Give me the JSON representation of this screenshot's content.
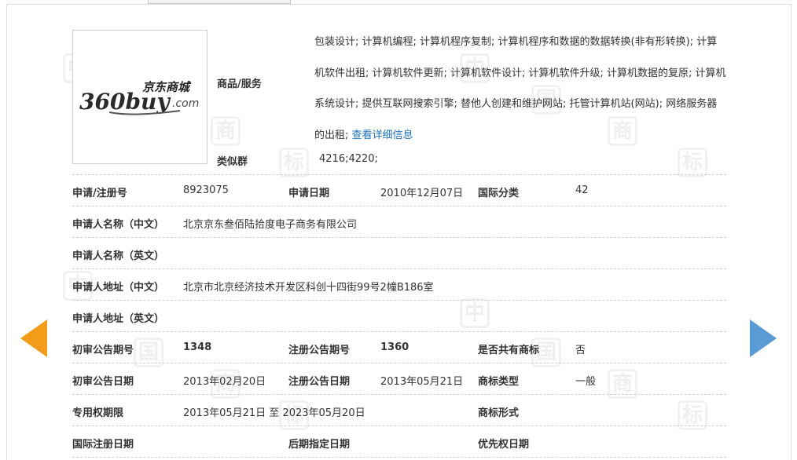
{
  "logo": {
    "brand_cn": "京东商城",
    "brand_en": "360buy",
    "brand_dotcom": ".com"
  },
  "goods": {
    "label": "商品/服务",
    "text": "包装设计; 计算机编程; 计算机程序复制; 计算机程序和数据的数据转换(非有形转换); 计算机软件出租; 计算机软件更新; 计算机软件设计; 计算机软件升级; 计算机数据的复原; 计算机系统设计; 提供互联网搜索引擎; 替他人创建和维护网站; 托管计算机站(网站); 网络服务器的出租; ",
    "detail_link": "查看详细信息"
  },
  "similar_group": {
    "label": "类似群",
    "value": "4216;4220;"
  },
  "reg_no": {
    "label": "申请/注册号",
    "value": "8923075"
  },
  "apply_date": {
    "label": "申请日期",
    "value": "2010年12月07日"
  },
  "intl_class": {
    "label": "国际分类",
    "value": "42"
  },
  "applicant_cn": {
    "label": "申请人名称（中文）",
    "value": "北京京东叁佰陆拾度电子商务有限公司"
  },
  "applicant_en": {
    "label": "申请人名称（英文）",
    "value": ""
  },
  "address_cn": {
    "label": "申请人地址（中文）",
    "value": "北京市北京经济技术开发区科创十四街99号2幢B186室"
  },
  "address_en": {
    "label": "申请人地址（英文）",
    "value": ""
  },
  "prelim_issue": {
    "label": "初审公告期号",
    "value": "1348"
  },
  "reg_issue": {
    "label": "注册公告期号",
    "value": "1360"
  },
  "shared": {
    "label": "是否共有商标",
    "value": "否"
  },
  "prelim_date": {
    "label": "初审公告日期",
    "value": "2013年02月20日"
  },
  "reg_date": {
    "label": "注册公告日期",
    "value": "2013年05月21日"
  },
  "tm_type": {
    "label": "商标类型",
    "value": "一般"
  },
  "exclusive": {
    "label": "专用权期限",
    "value": "2013年05月21日 至 2023年05月20日"
  },
  "tm_form": {
    "label": "商标形式",
    "value": ""
  },
  "intl_reg_date": {
    "label": "国际注册日期",
    "value": ""
  },
  "later_designation": {
    "label": "后期指定日期",
    "value": ""
  },
  "priority_date": {
    "label": "优先权日期",
    "value": ""
  },
  "watermark": {
    "chars": [
      "中",
      "国",
      "商",
      "标"
    ]
  },
  "colors": {
    "prev_arrow": "#f39c1a",
    "next_arrow": "#5b9bd5",
    "link": "#1e73be"
  }
}
